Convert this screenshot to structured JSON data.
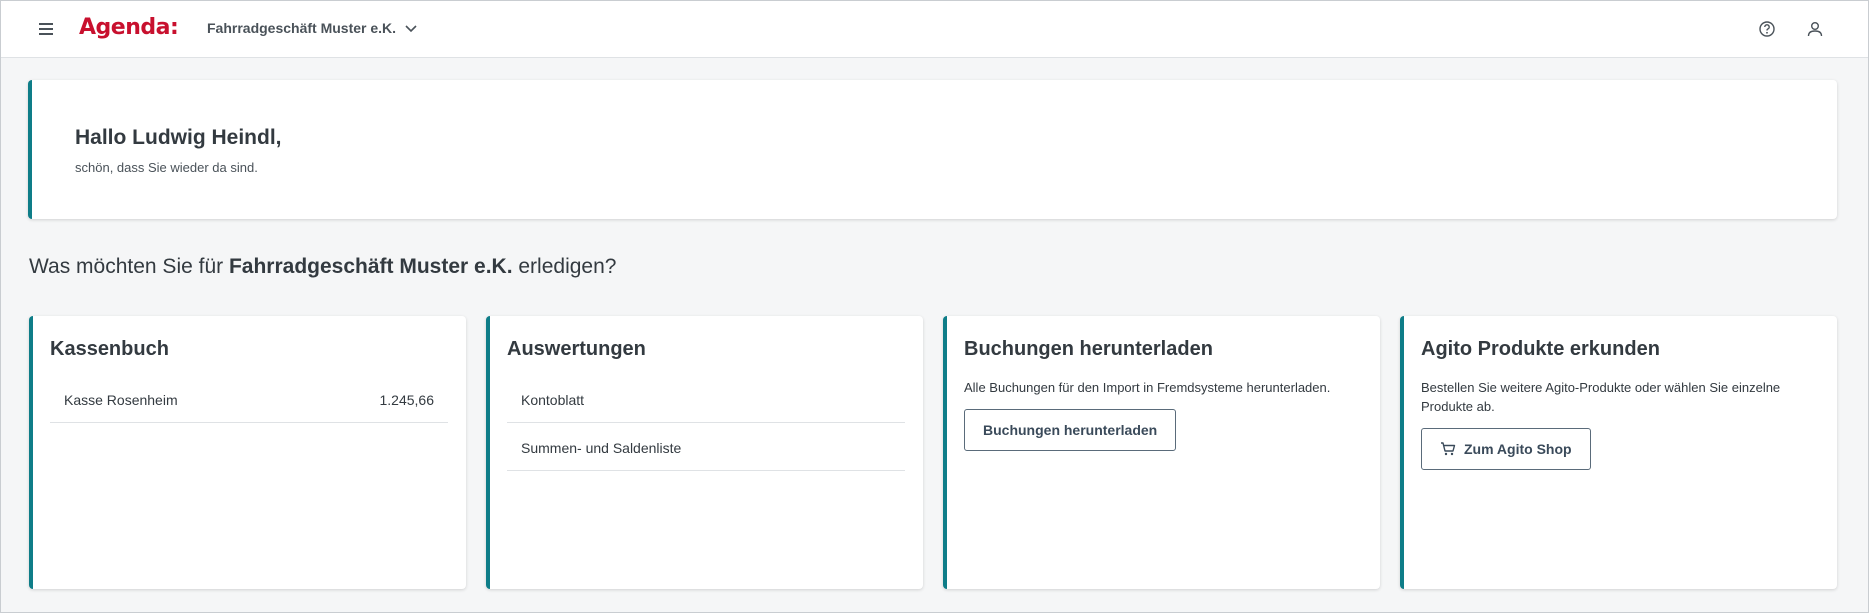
{
  "header": {
    "logo": "Agenda:",
    "company": "Fahrradgeschäft Muster e.K.",
    "icons": [
      "menu-icon",
      "chevron-down-icon",
      "help-icon",
      "user-icon"
    ]
  },
  "welcome": {
    "greeting": "Hallo Ludwig Heindl,",
    "subtitle": "schön, dass Sie wieder da sind."
  },
  "question": {
    "prefix": "Was möchten Sie für ",
    "company": "Fahrradgeschäft Muster e.K.",
    "suffix": " erledigen?"
  },
  "cards": {
    "kassenbuch": {
      "title": "Kassenbuch",
      "items": [
        {
          "label": "Kasse Rosenheim",
          "value": "1.245,66"
        }
      ]
    },
    "auswertungen": {
      "title": "Auswertungen",
      "items": [
        {
          "label": "Kontoblatt"
        },
        {
          "label": "Summen- und Saldenliste"
        }
      ]
    },
    "buchungen": {
      "title": "Buchungen herunterladen",
      "description": "Alle Buchungen für den Import in Fremdsysteme herunterladen.",
      "button": "Buchungen herunterladen"
    },
    "agito": {
      "title": "Agito Produkte erkunden",
      "description": "Bestellen Sie weitere Agito-Produkte oder wählen Sie einzelne Produkte ab.",
      "button": "Zum Agito Shop"
    }
  },
  "colors": {
    "brand": "#c8102e",
    "accent": "#0e7d88",
    "background": "#f5f6f7"
  }
}
